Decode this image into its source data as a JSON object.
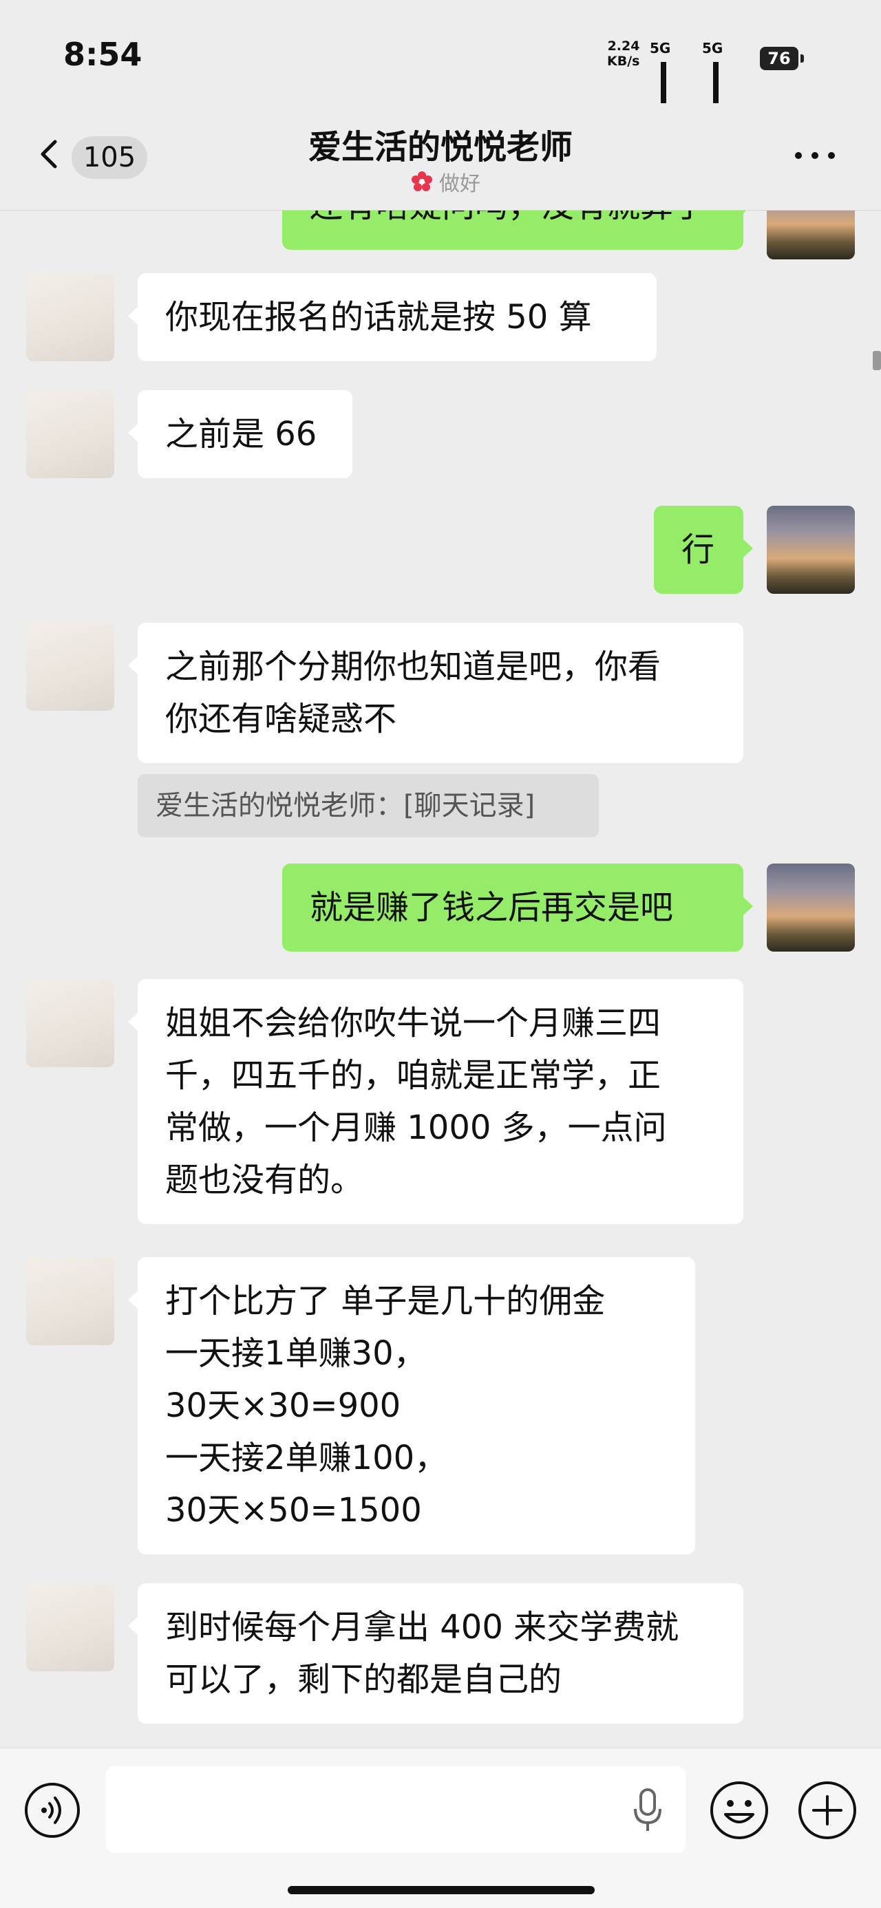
{
  "status_bar": {
    "time": "8:54",
    "net_speed_value": "2.24",
    "net_speed_unit": "KB/s",
    "sim1_label": "5G",
    "sim2_label": "5G",
    "battery": "76"
  },
  "nav": {
    "back_icon": "chevron-left-icon",
    "unread_count": "105",
    "title": "爱生活的悦悦老师",
    "subtitle": "做好",
    "more_icon": "ellipsis-icon"
  },
  "messages": [
    {
      "side": "out",
      "text": "还有啥疑问吗，没有就算了"
    },
    {
      "side": "in",
      "text": "你现在报名的话就是按 50 算"
    },
    {
      "side": "in",
      "text": "之前是 66"
    },
    {
      "side": "out",
      "text": "行"
    },
    {
      "side": "in",
      "text": "之前那个分期你也知道是吧，你看\n你还有啥疑惑不"
    },
    {
      "side": "quote",
      "text": "爱生活的悦悦老师：[聊天记录]"
    },
    {
      "side": "out",
      "text": "就是赚了钱之后再交是吧"
    },
    {
      "side": "in",
      "text": "姐姐不会给你吹牛说一个月赚三四\n千，四五千的，咱就是正常学，正\n常做，一个月赚 1000 多，一点问\n题也没有的。"
    },
    {
      "side": "in",
      "text": "打个比方了  单子是几十的佣金\n一天接1单赚30，\n30天×30=900\n一天接2单赚100，\n30天×50=1500"
    },
    {
      "side": "in",
      "text": "到时候每个月拿出 400 来交学费就\n可以了，剩下的都是自己的"
    }
  ],
  "input_bar": {
    "voice_icon": "voice-icon",
    "text_value": "",
    "mic_icon": "mic-icon",
    "emoji_icon": "emoji-icon",
    "plus_icon": "plus-icon"
  },
  "colors": {
    "background": "#ededed",
    "outgoing_bubble": "#95ec69",
    "incoming_bubble": "#ffffff"
  }
}
